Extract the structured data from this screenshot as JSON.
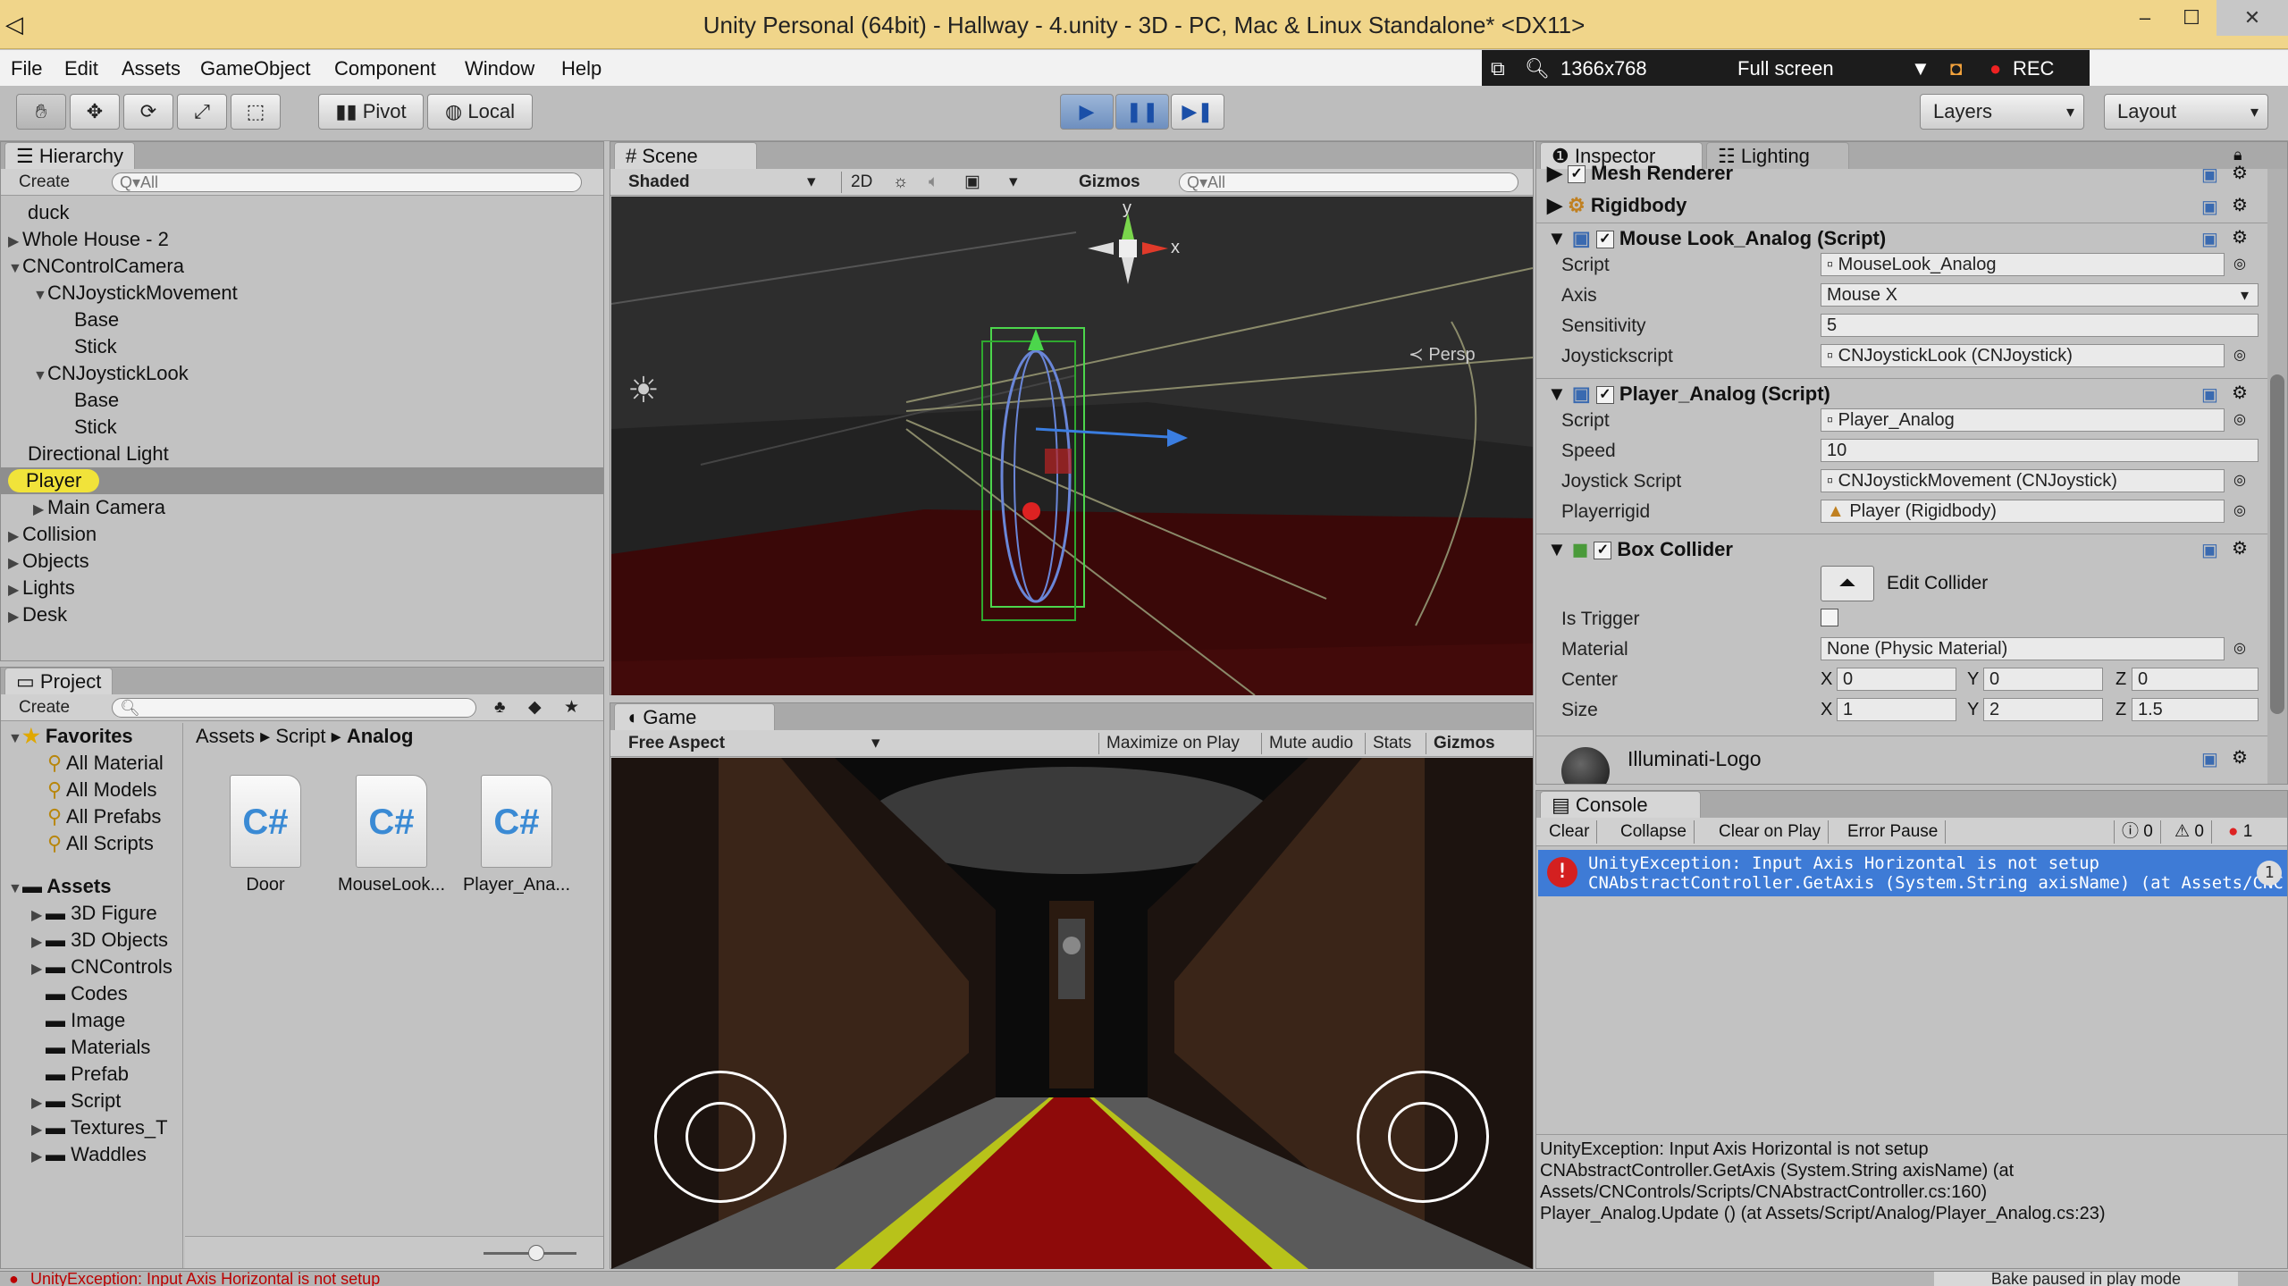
{
  "window": {
    "title": "Unity Personal (64bit) - Hallway - 4.unity - 3D - PC, Mac & Linux Standalone* <DX11>",
    "min": "–",
    "max": "☐",
    "close": "✕"
  },
  "menu": [
    "File",
    "Edit",
    "Assets",
    "GameObject",
    "Component",
    "Window",
    "Help"
  ],
  "recorder": {
    "resolution": "1366x768",
    "mode": "Full screen",
    "rec": "REC"
  },
  "toolbar": {
    "pivot": "Pivot",
    "local": "Local",
    "layers": "Layers",
    "layout": "Layout"
  },
  "hierarchy": {
    "tab": "Hierarchy",
    "create": "Create",
    "search": "Q▾All",
    "items": [
      {
        "label": "duck"
      },
      {
        "label": "Whole House - 2"
      },
      {
        "label": "CNControlCamera"
      },
      {
        "label": "CNJoystickMovement"
      },
      {
        "label": "Base"
      },
      {
        "label": "Stick"
      },
      {
        "label": "CNJoystickLook"
      },
      {
        "label": "Base"
      },
      {
        "label": "Stick"
      },
      {
        "label": "Directional Light"
      },
      {
        "label": "Player"
      },
      {
        "label": "Main Camera"
      },
      {
        "label": "Collision"
      },
      {
        "label": "Objects"
      },
      {
        "label": "Lights"
      },
      {
        "label": "Desk"
      }
    ]
  },
  "project": {
    "tab": "Project",
    "create": "Create",
    "favorites": "Favorites",
    "fav_items": [
      "All Material",
      "All Models",
      "All Prefabs",
      "All Scripts"
    ],
    "assets": "Assets",
    "folders": [
      "3D Figure",
      "3D Objects",
      "CNControls",
      "Codes",
      "Image",
      "Materials",
      "Prefab",
      "Script",
      "Textures_T",
      "Waddles"
    ],
    "breadcrumb": [
      "Assets",
      "Script",
      "Analog"
    ],
    "files": [
      "Door",
      "MouseLook...",
      "Player_Ana..."
    ],
    "cs": "C#"
  },
  "scene": {
    "tab": "Scene",
    "shading": "Shaded",
    "mode2d": "2D",
    "gizmos": "Gizmos",
    "search": "Q▾All",
    "persp": "Persp",
    "axis_x": "x",
    "axis_y": "y"
  },
  "game": {
    "tab": "Game",
    "aspect": "Free Aspect",
    "buttons": [
      "Maximize on Play",
      "Mute audio",
      "Stats",
      "Gizmos"
    ]
  },
  "inspector": {
    "tab": "Inspector",
    "tab2": "Lighting",
    "components": {
      "mesh_renderer": "Mesh Renderer",
      "rigidbody": "Rigidbody",
      "mouse_look": "Mouse Look_Analog (Script)",
      "player_analog": "Player_Analog (Script)",
      "box_collider": "Box Collider",
      "material_name": "Illuminati-Logo"
    },
    "mouse_look": {
      "script_label": "Script",
      "script": "MouseLook_Analog",
      "axis_label": "Axis",
      "axis": "Mouse X",
      "sens_label": "Sensitivity",
      "sens": "5",
      "js_label": "Joystickscript",
      "js": "CNJoystickLook (CNJoystick)"
    },
    "player": {
      "script_label": "Script",
      "script": "Player_Analog",
      "speed_label": "Speed",
      "speed": "10",
      "js_label": "Joystick Script",
      "js": "CNJoystickMovement (CNJoystick)",
      "rb_label": "Playerrigid",
      "rb": "Player (Rigidbody)"
    },
    "box": {
      "edit": "Edit Collider",
      "trigger_label": "Is Trigger",
      "material_label": "Material",
      "material": "None (Physic Material)",
      "center_label": "Center",
      "size_label": "Size",
      "X": "X",
      "Y": "Y",
      "Z": "Z",
      "center": [
        "0",
        "0",
        "0"
      ],
      "size": [
        "1",
        "2",
        "1.5"
      ]
    }
  },
  "console": {
    "tab": "Console",
    "buttons": [
      "Clear",
      "Collapse",
      "Clear on Play",
      "Error Pause"
    ],
    "counts": [
      "0",
      "0",
      "1"
    ],
    "entry_line1": "UnityException: Input Axis Horizontal is not setup",
    "entry_line2": "CNAbstractController.GetAxis (System.String axisName) (at Assets/CNC",
    "entry_count": "1",
    "detail": [
      "UnityException: Input Axis Horizontal is not setup",
      "CNAbstractController.GetAxis (System.String axisName) (at",
      "Assets/CNControls/Scripts/CNAbstractController.cs:160)",
      "Player_Analog.Update () (at Assets/Script/Analog/Player_Analog.cs:23)"
    ]
  },
  "status": {
    "left": "UnityException: Input Axis Horizontal is not setup",
    "right": "Bake paused in play mode"
  }
}
